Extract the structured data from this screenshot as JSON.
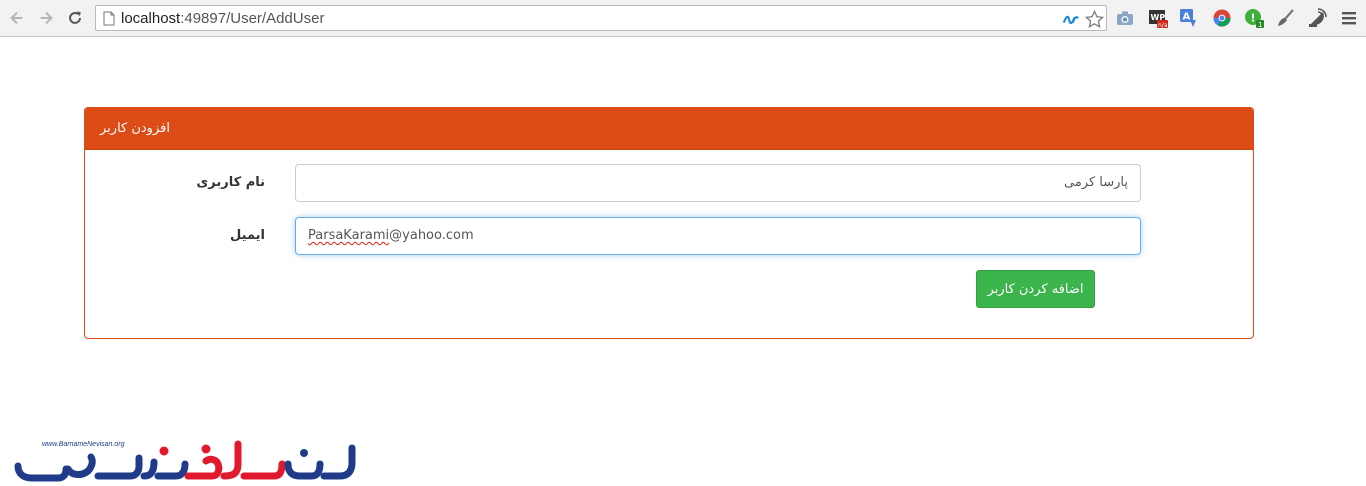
{
  "browser": {
    "url_host": "localhost",
    "url_path": ":49897/User/AddUser",
    "icons": [
      "back-icon",
      "forward-icon",
      "reload-icon",
      "page-icon",
      "dotnet-icon",
      "star-icon",
      "camera-icon",
      "wp-icon",
      "translate-icon",
      "chrome-ext-icon",
      "green-ext-icon",
      "broom-icon",
      "satellite-icon",
      "menu-icon"
    ]
  },
  "panel": {
    "title": "افزودن کاربر",
    "username_label": "نام کاربری",
    "username_value": "پارسا کرمی",
    "email_label": "ایمیل",
    "email_value_typo": "ParsaKarami",
    "email_value_rest": "@yahoo.com",
    "submit_label": "اضافه کردن کاربر"
  },
  "watermark": {
    "url": "www.BarnameNevisan.org"
  },
  "colors": {
    "panel_accent": "#dd4b16",
    "button_green": "#3cb44c",
    "focus_blue": "#66afe9",
    "logo_blue": "#1f3b8a",
    "logo_red": "#e0192d"
  }
}
